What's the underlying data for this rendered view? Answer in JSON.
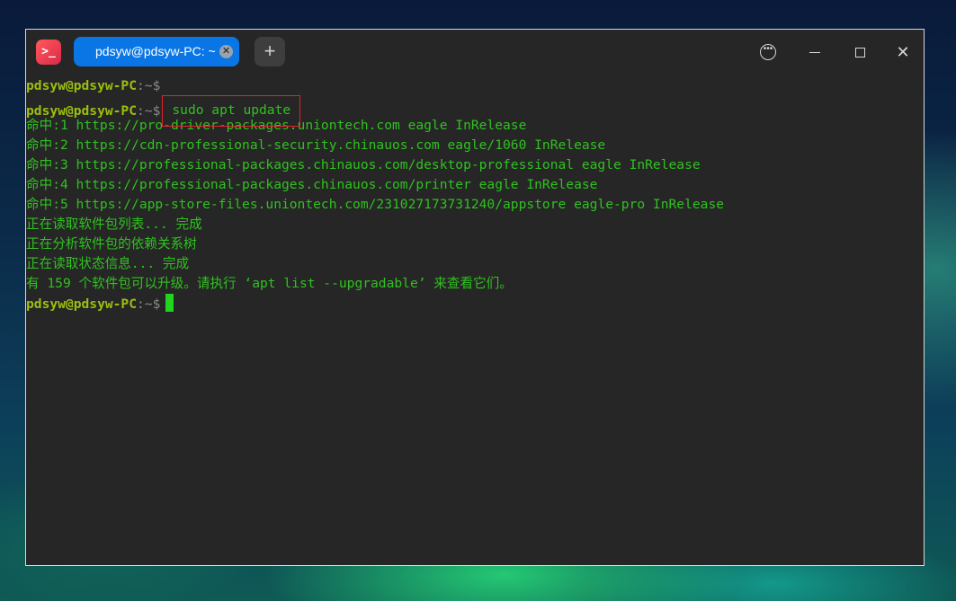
{
  "titlebar": {
    "tab_title": "pdsyw@pdsyw-PC: ~",
    "tab_close_icon": "close-icon",
    "new_tab_icon": "plus-icon",
    "menu_icon": "more-icon",
    "minimize_icon": "minimize-icon",
    "maximize_icon": "maximize-icon",
    "close_icon": "close-icon"
  },
  "terminal": {
    "prompt_user": "pdsyw@pdsyw-PC",
    "prompt_sep": ":~$",
    "command": "sudo apt update",
    "output": [
      "命中:1 https://pro-driver-packages.uniontech.com eagle InRelease",
      "命中:2 https://cdn-professional-security.chinauos.com eagle/1060 InRelease",
      "命中:3 https://professional-packages.chinauos.com/desktop-professional eagle InRelease",
      "命中:4 https://professional-packages.chinauos.com/printer eagle InRelease",
      "命中:5 https://app-store-files.uniontech.com/231027173731240/appstore eagle-pro InRelease",
      "正在读取软件包列表... 完成",
      "正在分析软件包的依赖关系树",
      "正在读取状态信息... 完成",
      "有 159 个软件包可以升级。请执行 ‘apt list --upgradable’ 来查看它们。"
    ],
    "colors": {
      "background": "#262626",
      "prompt_user": "#9bbf0f",
      "text": "#2fc21f",
      "highlight_box": "#e0242a",
      "cursor": "#23d41e"
    }
  }
}
